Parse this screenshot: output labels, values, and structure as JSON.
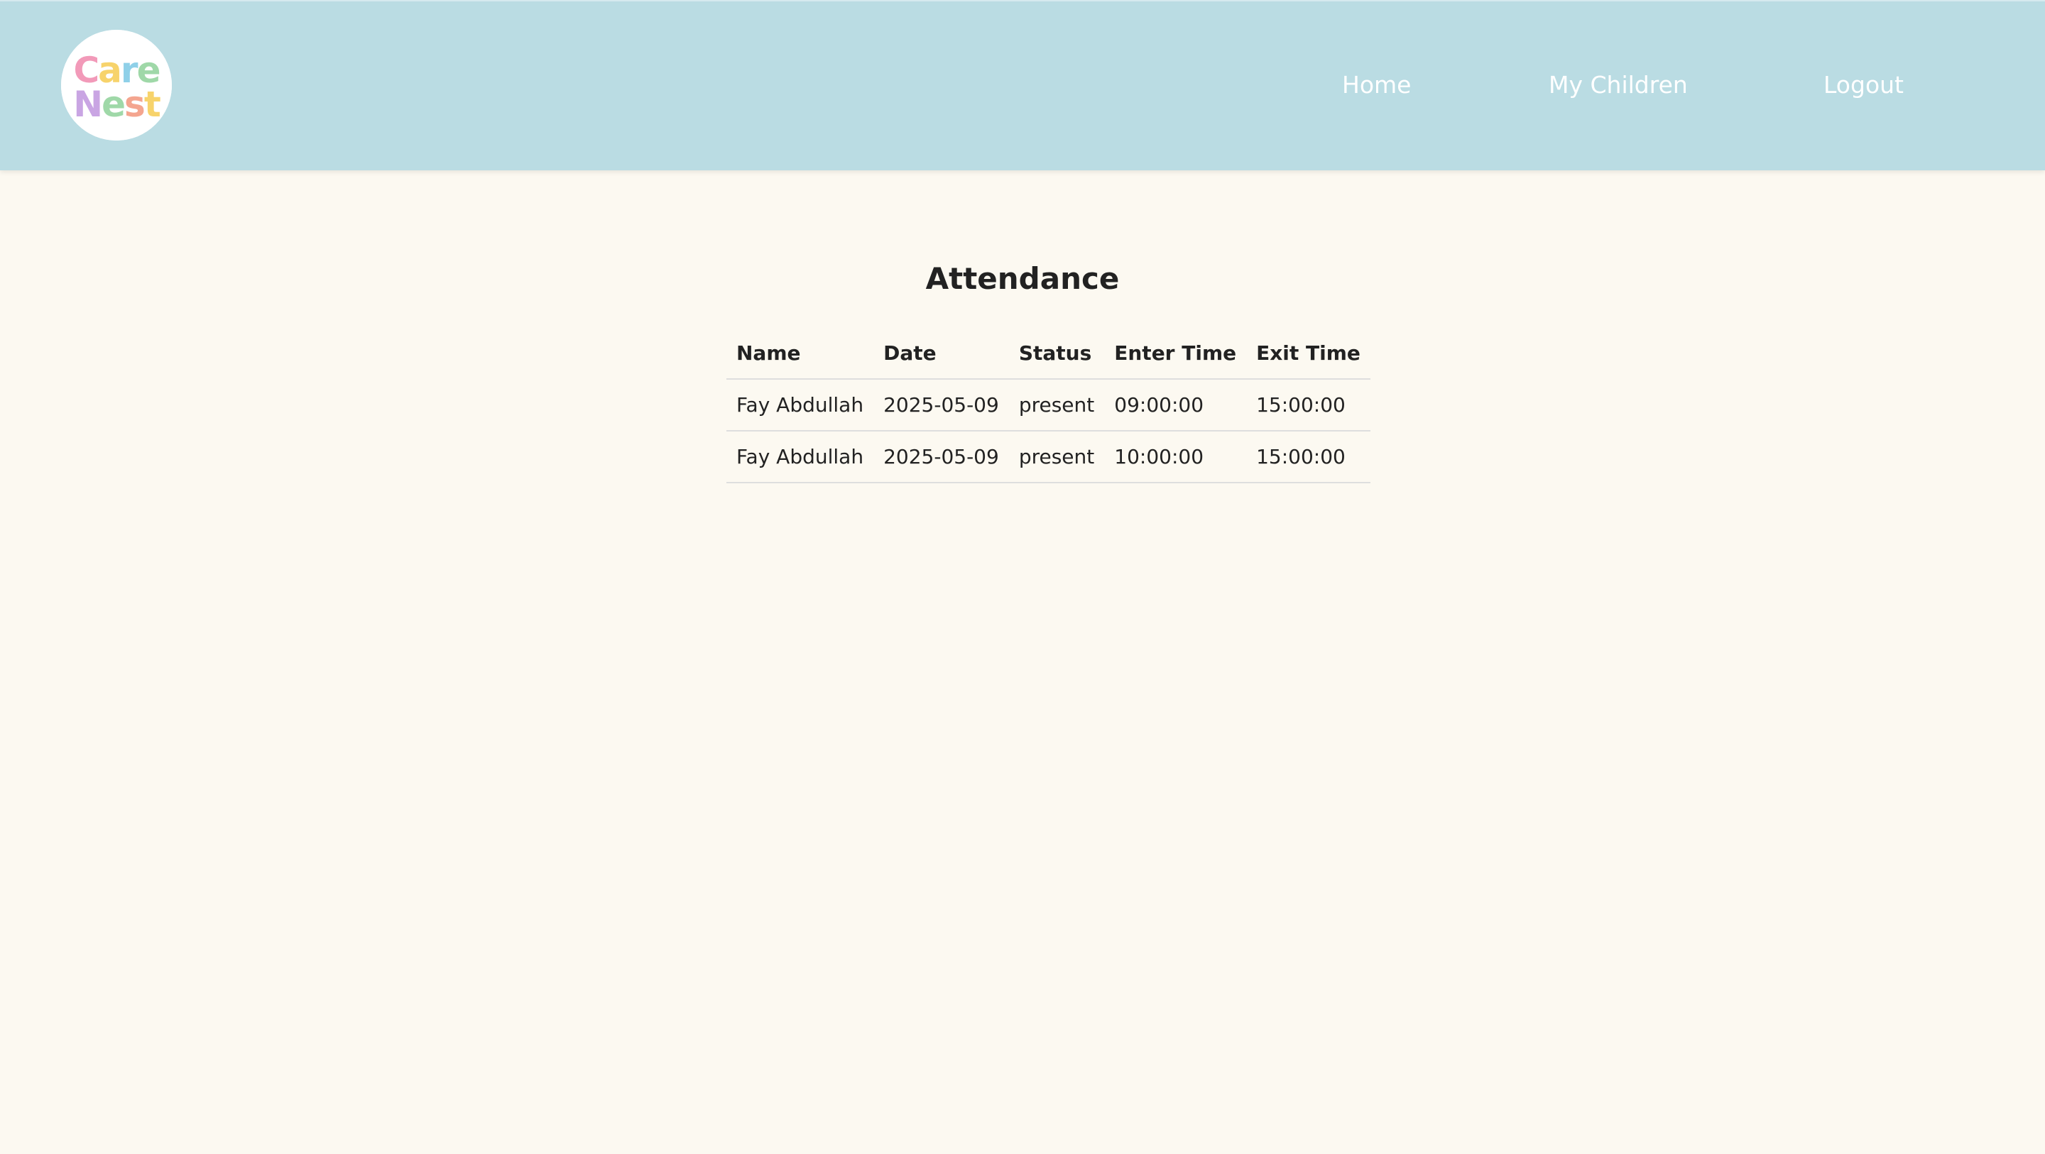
{
  "brand": {
    "logo_line1": "Care",
    "logo_line2": "Nest"
  },
  "nav": {
    "home": "Home",
    "my_children": "My Children",
    "logout": "Logout"
  },
  "page": {
    "title": "Attendance"
  },
  "table": {
    "columns": [
      "Name",
      "Date",
      "Status",
      "Enter Time",
      "Exit Time"
    ],
    "rows": [
      [
        "Fay Abdullah",
        "2025-05-09",
        "present",
        "09:00:00",
        "15:00:00"
      ],
      [
        "Fay Abdullah",
        "2025-05-09",
        "present",
        "10:00:00",
        "15:00:00"
      ]
    ]
  },
  "colors": {
    "header_bg": "#badce3",
    "page_bg": "#fcf9f1",
    "nav_text": "#ffffff",
    "logo_c": "#f29ab9",
    "logo_a": "#f7d36b",
    "logo_r": "#8fd0e8",
    "logo_e1": "#9fd8a8",
    "logo_n": "#c9a5e3",
    "logo_e2": "#f4a58f",
    "logo_s": "#8fd0e8",
    "logo_t": "#f7d36b"
  }
}
